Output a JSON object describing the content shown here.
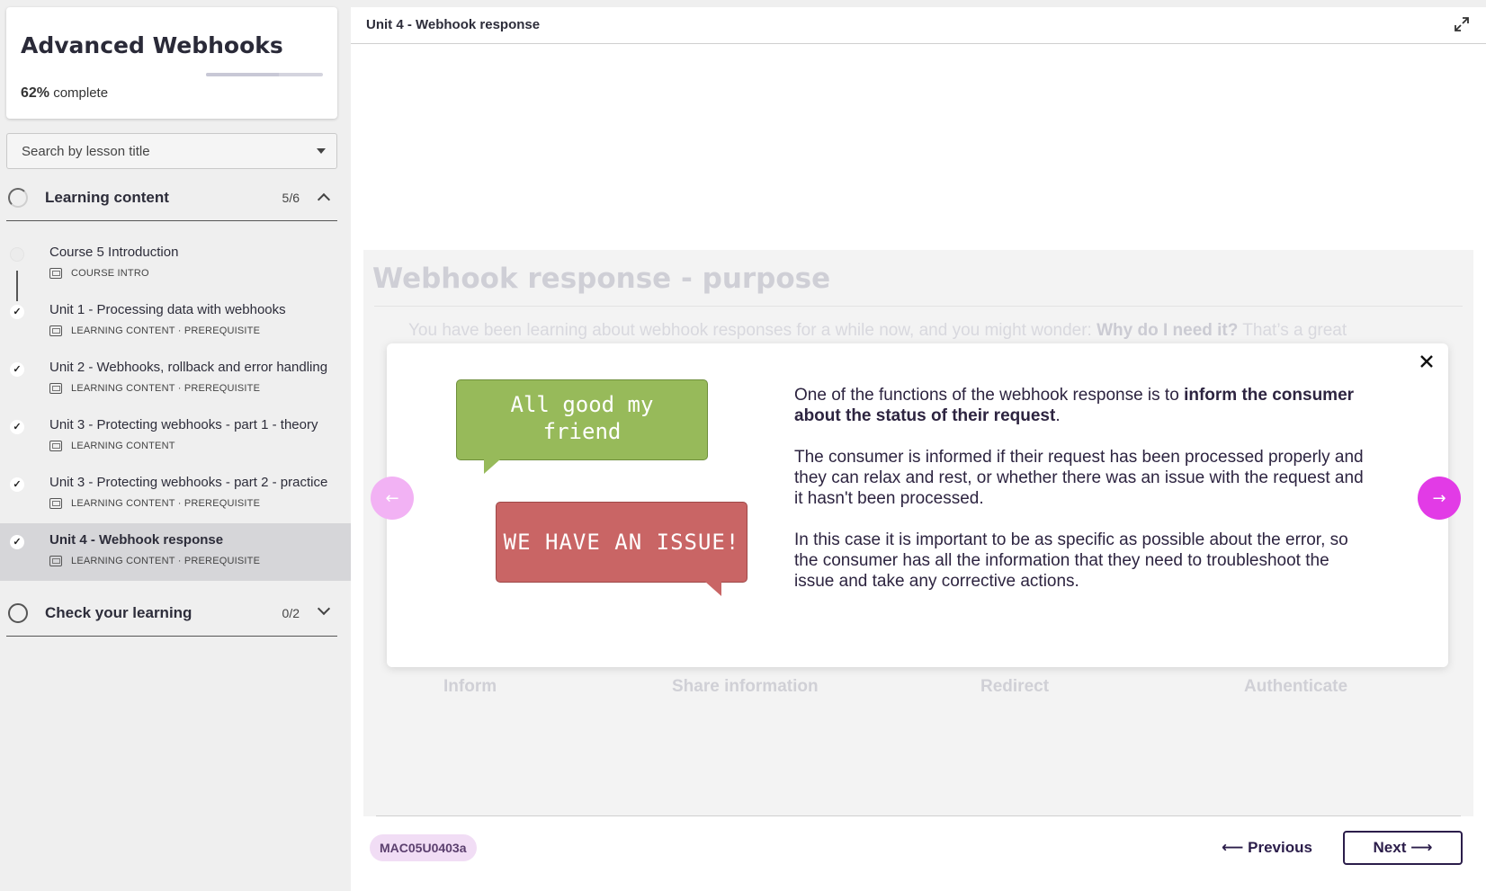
{
  "course": {
    "title": "Advanced Webhooks",
    "progress_percent": 62,
    "progress_value": "62%",
    "progress_suffix": " complete"
  },
  "search": {
    "placeholder": "Search by lesson title"
  },
  "sections": [
    {
      "label": "Learning content",
      "count": "5/6",
      "expanded": true
    },
    {
      "label": "Check your learning",
      "count": "0/2",
      "expanded": false
    }
  ],
  "lessons": [
    {
      "title": "Course 5 Introduction",
      "meta": "COURSE INTRO",
      "status": "not-started"
    },
    {
      "title": "Unit 1 - Processing data with webhooks",
      "meta": "LEARNING CONTENT · PREREQUISITE",
      "status": "complete"
    },
    {
      "title": "Unit 2 - Webhooks, rollback and error handling",
      "meta": "LEARNING CONTENT · PREREQUISITE",
      "status": "complete"
    },
    {
      "title": "Unit 3 - Protecting webhooks - part 1 - theory",
      "meta": "LEARNING CONTENT",
      "status": "complete"
    },
    {
      "title": "Unit 3 - Protecting webhooks - part 2 - practice",
      "meta": "LEARNING CONTENT · PREREQUISITE",
      "status": "complete"
    },
    {
      "title": "Unit 4 - Webhook response",
      "meta": "LEARNING CONTENT · PREREQUISITE",
      "status": "complete",
      "active": true
    }
  ],
  "main": {
    "unit_title": "Unit 4 - Webhook response",
    "stage_title": "Webhook response - purpose",
    "intro_start": "You have been learning about webhook responses for a while now, and you might wonder: ",
    "intro_bold": "Why do I need it?",
    "intro_end": " That’s a great",
    "tabs": [
      "Inform",
      "Share information",
      "Redirect",
      "Authenticate"
    ]
  },
  "modal": {
    "bubble_good_line1": "All good my",
    "bubble_good_line2": "friend",
    "bubble_issue": "WE HAVE AN ISSUE!",
    "p1_start": "One of the functions of the webhook response is to ",
    "p1_bold": "inform the consumer about the status of their request",
    "p1_end": ".",
    "p2": "The consumer is informed if their request has been processed properly and they can relax and rest, or whether there was an issue with the request and it hasn't been processed.",
    "p3": "In this case it is important to be as specific as possible about the error, so the consumer has all the information that they need to troubleshoot the issue and take any corrective actions."
  },
  "footer": {
    "code": "MAC05U0403a",
    "previous_label": "Previous",
    "next_label": "Next"
  },
  "icons": {
    "checkmark": "check-icon",
    "expand": "expand-icon",
    "close": "close-icon",
    "lesson_type": "slides-icon"
  },
  "colors": {
    "accent_magenta": "#e23be6",
    "accent_magenta_light": "#f2b2f4",
    "bubble_green": "#97ba5a",
    "bubble_red": "#c96565",
    "badge_bg": "#f1ddf5",
    "primary_dark": "#2b1d4a"
  }
}
